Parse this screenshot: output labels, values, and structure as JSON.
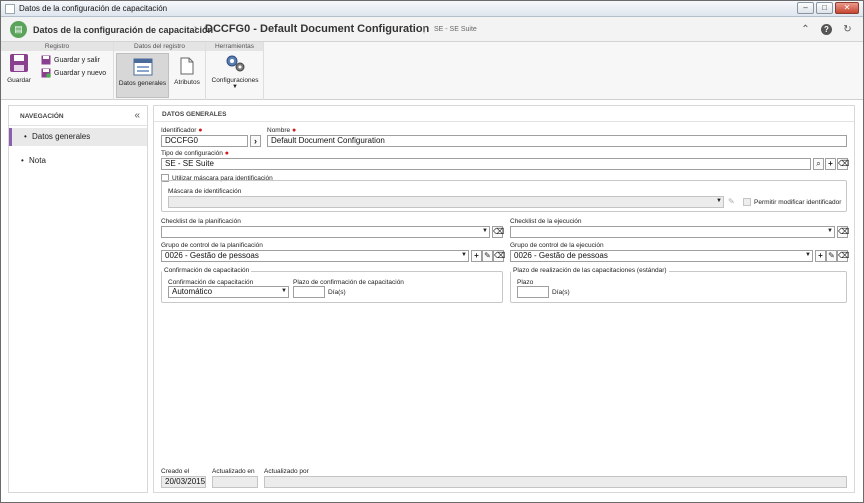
{
  "window": {
    "title": "Datos de la configuración de capacitación"
  },
  "header": {
    "crumb1": "Datos de la configuración de capacitación",
    "separator": "›",
    "crumb2": "DCCFG0 - Default Document Configuration",
    "suite": "SE - SE Suite"
  },
  "ribbon": {
    "groups": {
      "registro": "Registro",
      "datos": "Datos del registro",
      "herramientas": "Herramientas"
    },
    "save": "Guardar",
    "save_exit": "Guardar y salir",
    "save_new": "Guardar y nuevo",
    "general_data": "Datos generales",
    "attributes": "Atributos",
    "settings": "Configuraciones"
  },
  "nav": {
    "title": "NAVEGACIÓN",
    "items": [
      {
        "label": "Datos generales"
      },
      {
        "label": "Nota"
      }
    ]
  },
  "form": {
    "section_title": "DATOS GENERALES",
    "identifier": {
      "label": "Identificador",
      "value": "DCCFG0"
    },
    "name": {
      "label": "Nombre",
      "value": "Default Document Configuration"
    },
    "config_type": {
      "label": "Tipo de configuración",
      "value": "SE - SE Suite"
    },
    "use_mask": {
      "label": "Utilizar máscara para identificación",
      "checked": false
    },
    "mask": {
      "label": "Máscara de identificación",
      "value": ""
    },
    "allow_modify": {
      "label": "Permitir modificar identificador"
    },
    "checklist_plan": {
      "label": "Checklist de la planificación",
      "value": ""
    },
    "checklist_exec": {
      "label": "Checklist de la ejecución",
      "value": ""
    },
    "control_plan": {
      "label": "Grupo de control de la planificación",
      "value": "0026 - Gestão de pessoas"
    },
    "control_exec": {
      "label": "Grupo de control de la ejecución",
      "value": "0026 - Gestão de pessoas"
    },
    "confirmation_group": {
      "label": "Confirmación de capacitación",
      "confirm_label": "Confirmación de capacitación",
      "confirm_value": "Automático",
      "term_label": "Plazo de confirmación de capacitación",
      "term_value": "",
      "term_unit": "Día(s)"
    },
    "completion_group": {
      "label": "Plazo de realización de las capacitaciones (estándar)",
      "term_label": "Plazo",
      "term_value": "",
      "term_unit": "Día(s)"
    },
    "footer": {
      "created_label": "Creado el",
      "created_value": "20/03/2015",
      "updated_label": "Actualizado en",
      "updated_value": "",
      "updated_by_label": "Actualizado por",
      "updated_by_value": ""
    }
  },
  "colors": {
    "accent": "#8a5fb0",
    "required": "#d21a1a",
    "logo": "#5aa35a"
  }
}
